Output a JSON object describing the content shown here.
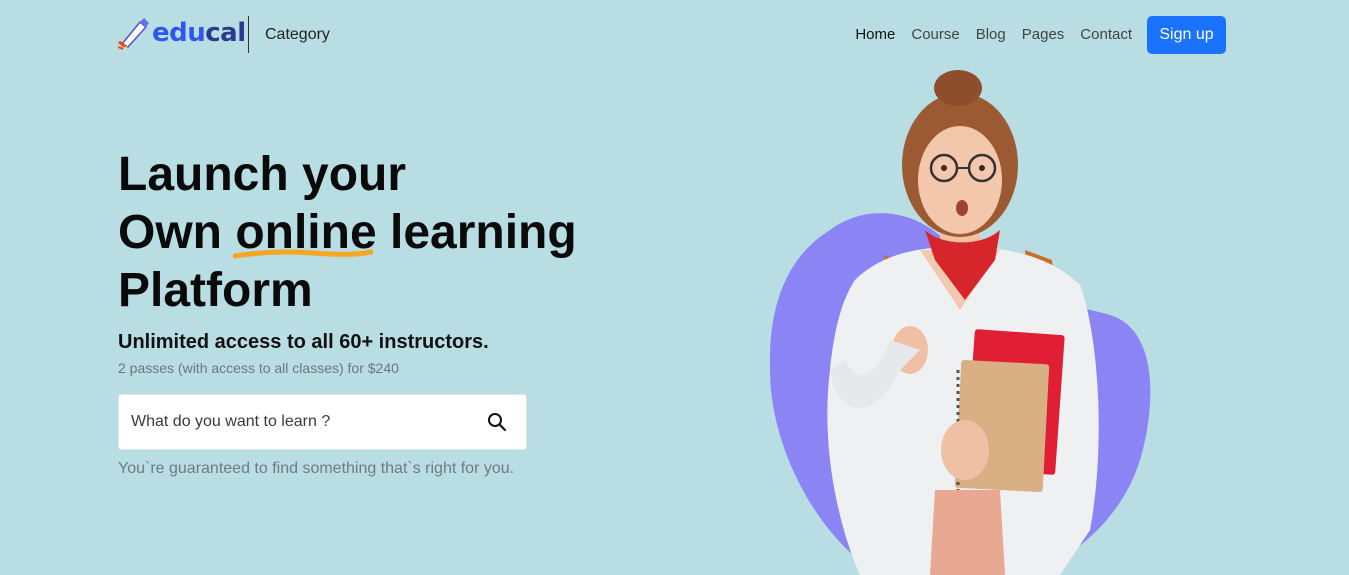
{
  "header": {
    "logo_parts": [
      "edu",
      "cal"
    ],
    "category_label": "Category",
    "nav": [
      {
        "label": "Home",
        "active": true
      },
      {
        "label": "Course",
        "active": false
      },
      {
        "label": "Blog",
        "active": false
      },
      {
        "label": "Pages",
        "active": false
      },
      {
        "label": "Contact",
        "active": false
      }
    ],
    "signup_label": "Sign up"
  },
  "hero": {
    "title_line1": "Launch your",
    "title_line2_before": "Own ",
    "title_line2_highlight": "online",
    "title_line2_after": " learning",
    "title_line3": "Platform",
    "subtitle": "Unlimited access to all 60+ instructors.",
    "price_note": "2 passes (with access to all classes) for $240",
    "search": {
      "placeholder": "What do you want to learn ?",
      "icon": "search-icon"
    },
    "guarantee": "You`re guaranteed to find something that`s right for you."
  },
  "colors": {
    "background": "#b8dde2",
    "accent": "#1a73ff",
    "blob": "#8b84f5",
    "highlight_underline": "#f5a623"
  }
}
